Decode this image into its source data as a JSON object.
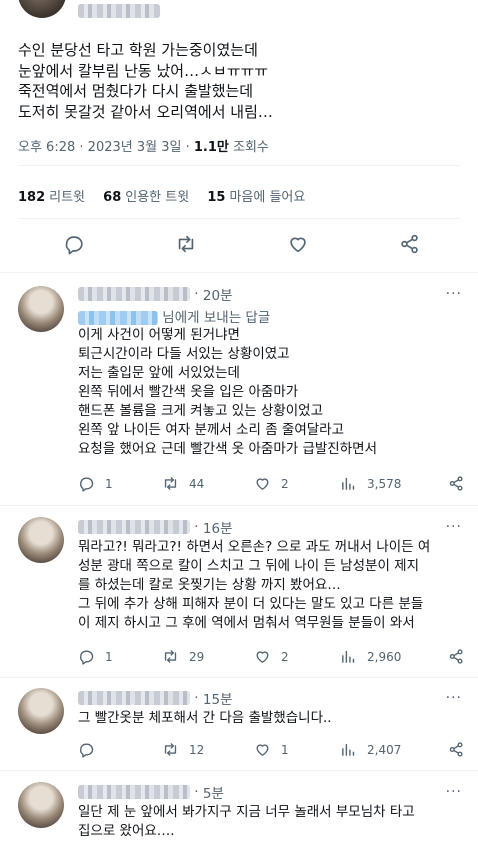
{
  "main": {
    "lines": [
      "수인 분당선 타고 학원 가는중이였는데",
      "눈앞에서 칼부림 난동 났어…ㅅㅂㅠㅠㅠ",
      "죽전역에서 멈췄다가 다시 출발했는데",
      "도저히 못갈것 같아서 오리역에서 내림…"
    ],
    "time": "오후 6:28",
    "date": "2023년 3월 3일",
    "views_count": "1.1만",
    "views_label": "조회수",
    "retweets_count": "182",
    "retweets_label": "리트윗",
    "quotes_count": "68",
    "quotes_label": "인용한 트윗",
    "likes_count": "15",
    "likes_label": "마음에 들어요"
  },
  "replies": [
    {
      "time": "20분",
      "reply_to_suffix": "님에게 보내는 답글",
      "lines": [
        "이게 사건이 어떻게 된거냐면",
        "퇴근시간이라 다들 서있는 상황이였고",
        "저는 출입문 앞에 서있었는데",
        "왼쪽 뒤에서 빨간색 옷을 입은 아줌마가",
        "핸드폰 볼륨을 크게 켜놓고 있는 상황이었고",
        "왼쪽 앞 나이든 여자 분께서 소리 좀 줄여달라고",
        "요청을 했어요 근데 빨간색 옷 아줌마가 급발진하면서"
      ],
      "replies": "1",
      "retweets": "44",
      "likes": "2",
      "views": "3,578"
    },
    {
      "time": "16분",
      "lines": [
        "뭐라고?! 뭐라고?! 하면서 오른손? 으로 과도 꺼내서 나이든 여",
        "성분 광대 쪽으로 칼이 스치고 그 뒤에 나이 든 남성분이 제지",
        "를 하셨는데 칼로 옷찢기는 상황 까지 봤어요…",
        "그 뒤에 추가 상해 피해자 분이 더 있다는 말도 있고 다른 분들",
        "이 제지 하시고 그 후에 역에서 멈춰서 역무원들 분들이 와서"
      ],
      "replies": "1",
      "retweets": "29",
      "likes": "2",
      "views": "2,960"
    },
    {
      "time": "15분",
      "lines": [
        "그 빨간옷분 체포해서 간 다음 출발했습니다.."
      ],
      "replies": "",
      "retweets": "12",
      "likes": "1",
      "views": "2,407"
    },
    {
      "time": "5분",
      "lines": [
        "일단 제 눈 앞에서 봐가지구 지금 너무 놀래서 부모님차 타고",
        "집으로 왔어요…."
      ]
    }
  ],
  "separator": "·",
  "more_glyph": "···"
}
